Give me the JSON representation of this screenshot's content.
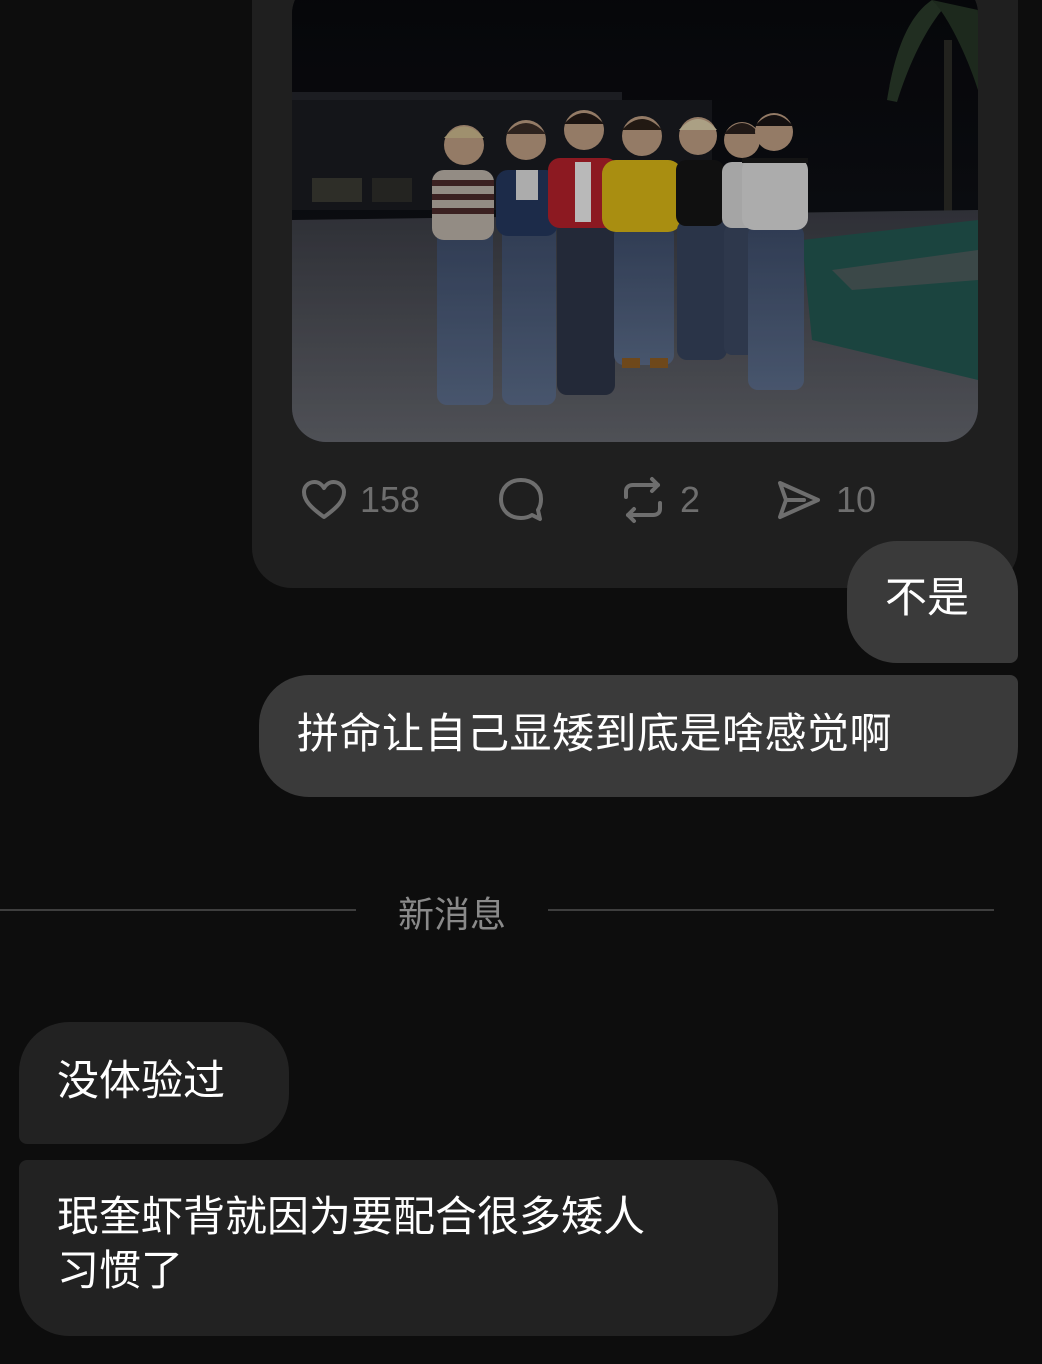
{
  "post": {
    "image_alt": "Seven people in denim standing together at night",
    "likes": "158",
    "reposts": "2",
    "shares": "10"
  },
  "messages": {
    "outgoing": [
      {
        "text": "不是"
      },
      {
        "text": "拼命让自己显矮到底是啥感觉啊"
      }
    ],
    "divider_label": "新消息",
    "incoming": [
      {
        "text": "没体验过"
      },
      {
        "line1": "珉奎虾背就因为要配合很多矮人",
        "line2": "习惯了"
      }
    ]
  },
  "icons": {
    "like": "heart-icon",
    "comment": "comment-bubble-icon",
    "repost": "repost-arrows-icon",
    "share": "send-paper-plane-icon"
  },
  "colors": {
    "background": "#0d0d0d",
    "card": "#1f1f1f",
    "bubble_outgoing": "#3a3a3a",
    "bubble_incoming": "#222222",
    "icon_gray": "#6e6e6e"
  }
}
